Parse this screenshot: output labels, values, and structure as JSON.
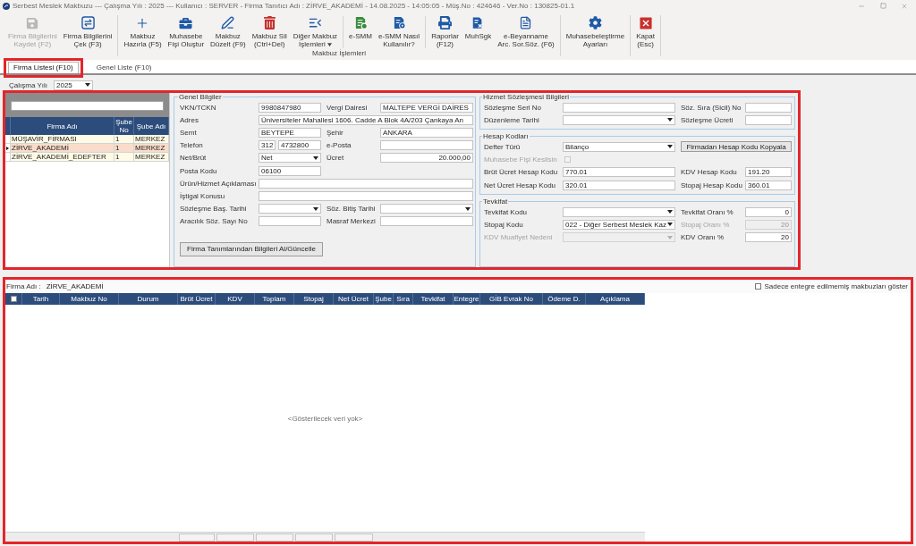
{
  "window": {
    "title": "Serbest Meslek Makbuzu --- Çalışma Yılı : 2025 --- Kullanıcı : SERVER - Firma Tanıtıcı Adı : ZİRVE_AKADEMİ - 14.08.2025 - 14:05:05 - Müş.No : 424646 - Ver.No : 130825-01.1"
  },
  "toolbar": {
    "groups": [
      {
        "sections": [
          [
            {
              "label": "Firma Bilgilerini\nKaydet (F2)",
              "disabled": true,
              "menu": false
            },
            {
              "label": "Firma Bilgilerini\nÇek (F3)",
              "disabled": false,
              "menu": false
            }
          ]
        ]
      },
      {
        "caption": "Makbuz İşlemleri",
        "sections": [
          [
            {
              "label": "Makbuz\nHazırla (F5)",
              "disabled": false,
              "menu": false
            },
            {
              "label": "Muhasebe\nFişi Oluştur",
              "disabled": false,
              "menu": false
            },
            {
              "label": "Makbuz\nDüzelt (F9)",
              "disabled": false,
              "menu": false
            },
            {
              "label": "Makbuz Sil\n(Ctrl+Del)",
              "disabled": false,
              "menu": false
            },
            {
              "label": "Diğer Makbuz\nİşlemleri",
              "disabled": false,
              "menu": true
            }
          ],
          [
            {
              "label": "e-SMM",
              "disabled": false,
              "menu": false
            },
            {
              "label": "e-SMM Nasıl\nKullanılır?",
              "disabled": false,
              "menu": false
            }
          ],
          [
            {
              "label": "Raporlar\n(F12)",
              "disabled": false,
              "menu": false
            },
            {
              "label": "MuhSgk",
              "disabled": false,
              "menu": false
            },
            {
              "label": "e-Beyanname\nArc. Sor.Söz. (F6)",
              "disabled": false,
              "menu": false
            }
          ]
        ]
      },
      {
        "sections": [
          [
            {
              "label": "Muhasebeleştirme\nAyarları",
              "disabled": false,
              "menu": false
            }
          ]
        ]
      },
      {
        "sections": [
          [
            {
              "label": "Kapat\n(Esc)",
              "disabled": false,
              "menu": false
            }
          ]
        ]
      }
    ]
  },
  "tabs": [
    {
      "label": "Firma Listesi (F10)",
      "selected": true,
      "highlighted": true
    },
    {
      "label": "Genel Liste (F10)",
      "selected": false,
      "highlighted": false
    }
  ],
  "year": {
    "label": "Çalışma Yılı",
    "value": "2025"
  },
  "firm_panel": {
    "highlighted": true,
    "firm_list": {
      "columns": [
        "Firma Adı",
        "Şube No",
        "Şube Adı"
      ],
      "rows": [
        {
          "cells": [
            "MÜŞAVİR_FİRMASI",
            "1",
            "MERKEZ"
          ],
          "selected": false
        },
        {
          "cells": [
            "ZİRVE_AKADEMİ",
            "1",
            "MERKEZ"
          ],
          "selected": true
        },
        {
          "cells": [
            "ZİRVE_AKADEMİ_EDEFTER",
            "1",
            "MERKEZ"
          ],
          "selected": false
        }
      ]
    },
    "general_info": {
      "title": "Genel Bilgiler",
      "rows": [
        [
          {
            "kind": "text",
            "label": "VKN/TCKN",
            "value": "9980847980",
            "disabled": false
          },
          {
            "kind": "text",
            "label": "Vergi Dairesi",
            "value": "MALTEPE VERGİ DAİRES",
            "disabled": false
          }
        ],
        [
          {
            "kind": "wide",
            "label": "Adres",
            "value": "Üniversiteler Mahallesi 1606. Cadde A Blok 4A/203 Çankaya An",
            "disabled": false
          }
        ],
        [
          {
            "kind": "text",
            "label": "Semt",
            "value": "BEYTEPE",
            "disabled": false
          },
          {
            "kind": "text",
            "label": "Şehir",
            "value": "ANKARA",
            "disabled": false
          }
        ],
        [
          {
            "kind": "phone",
            "label": "Telefon",
            "area_code": "312",
            "value": "4732800",
            "disabled": false
          },
          {
            "kind": "text",
            "label": "e-Posta",
            "disabled": false
          }
        ],
        [
          {
            "kind": "select",
            "label": "Net/Brüt",
            "value": "Net",
            "disabled": false
          },
          {
            "kind": "number",
            "label": "Ücret",
            "value": "20.000,00",
            "disabled": false
          }
        ],
        [
          {
            "kind": "text",
            "label": "Posta Kodu",
            "value": "06100",
            "disabled": false
          }
        ],
        [
          {
            "kind": "wide",
            "label": "Ürün/Hizmet Açıklaması",
            "disabled": false
          }
        ],
        [
          {
            "kind": "wide",
            "label": "İştigal Konusu",
            "disabled": false
          }
        ],
        [
          {
            "kind": "select",
            "label": "Sözleşme Baş. Tarihi",
            "disabled": false
          },
          {
            "kind": "select",
            "label": "Söz. Bitiş Tarihi",
            "disabled": false
          }
        ],
        [
          {
            "kind": "text",
            "label": "Aracılık Söz. Sayı No",
            "disabled": false
          },
          {
            "kind": "text",
            "label": "Masraf Merkezi",
            "disabled": false
          }
        ]
      ],
      "action_button": "Firma Tanımlarından Bilgileri Al/Güncelle"
    },
    "contract": {
      "title": "Hizmet Sözleşmesi Bilgileri",
      "rows": [
        [
          {
            "kind": "text",
            "label": "Sözleşme Seri No",
            "disabled": false
          },
          {
            "kind": "text",
            "label": "Söz. Sıra (Sicil) No",
            "disabled": false
          }
        ],
        [
          {
            "kind": "select",
            "label": "Düzenleme Tarihi",
            "disabled": false
          },
          {
            "kind": "text",
            "label": "Sözleşme Ücreti",
            "disabled": false
          }
        ]
      ]
    },
    "account_codes": {
      "title": "Hesap Kodları",
      "rows": [
        [
          {
            "kind": "select",
            "label": "Defter Türü",
            "value": "Bilanço",
            "disabled": false
          },
          {
            "kind": "button",
            "label": "Firmadan Hesap Kodu Kopyala",
            "disabled": false
          }
        ],
        [
          {
            "kind": "checkbox",
            "label": "Muhasebe Fişi Kesilsin",
            "checked": false,
            "disabled": true
          }
        ],
        [
          {
            "kind": "text",
            "label": "Brüt Ücret Hesap Kodu",
            "value": "770.01",
            "disabled": false
          },
          {
            "kind": "text",
            "label": "KDV Hesap Kodu",
            "value": "191.20",
            "disabled": false
          }
        ],
        [
          {
            "kind": "text",
            "label": "Net Ücret Hesap Kodu",
            "value": "320.01",
            "disabled": false
          },
          {
            "kind": "text",
            "label": "Stopaj Hesap Kodu",
            "value": "360.01",
            "disabled": false
          }
        ]
      ]
    },
    "withholding": {
      "title": "Tevkifat",
      "rows": [
        [
          {
            "kind": "select",
            "label": "Tevkifat Kodu",
            "disabled": false
          },
          {
            "kind": "number",
            "label": "Tevkifat Oranı %",
            "value": "0",
            "disabled": false
          }
        ],
        [
          {
            "kind": "select",
            "label": "Stopaj Kodu",
            "value": "022 - Diğer Serbest Meslek Kaz",
            "disabled": false
          },
          {
            "kind": "number",
            "label": "Stopaj Oranı %",
            "value": "20",
            "disabled": true
          }
        ],
        [
          {
            "kind": "select",
            "label": "KDV Muafiyet Nedeni",
            "disabled": true
          },
          {
            "kind": "number",
            "label": "KDV Oranı %",
            "value": "20",
            "disabled": false
          }
        ]
      ]
    }
  },
  "receipts": {
    "highlighted": true,
    "firm_label": "Firma Adı :",
    "firm_name": "ZİRVE_AKADEMİ",
    "filter": {
      "label": "Sadece entegre edilmemiş makbuzları göster",
      "checked": false
    },
    "select_all_checked": false,
    "columns": [
      {
        "label": "Tarih",
        "summary": false
      },
      {
        "label": "Makbuz No",
        "summary": false
      },
      {
        "label": "Durum",
        "summary": false
      },
      {
        "label": "Brüt Ücret",
        "summary": true
      },
      {
        "label": "KDV",
        "summary": true
      },
      {
        "label": "Toplam",
        "summary": true
      },
      {
        "label": "Stopaj",
        "summary": true
      },
      {
        "label": "Net Ücret",
        "summary": true
      },
      {
        "label": "Şube",
        "summary": false
      },
      {
        "label": "Sıra",
        "summary": false
      },
      {
        "label": "Tevkifat",
        "summary": false
      },
      {
        "label": "Entegre",
        "summary": false
      },
      {
        "label": "GİB Evrak No",
        "summary": false
      },
      {
        "label": "Ödeme D.",
        "summary": false
      },
      {
        "label": "Açıklama",
        "summary": false
      }
    ],
    "empty_text": "<Gösterilecek veri yok>"
  }
}
